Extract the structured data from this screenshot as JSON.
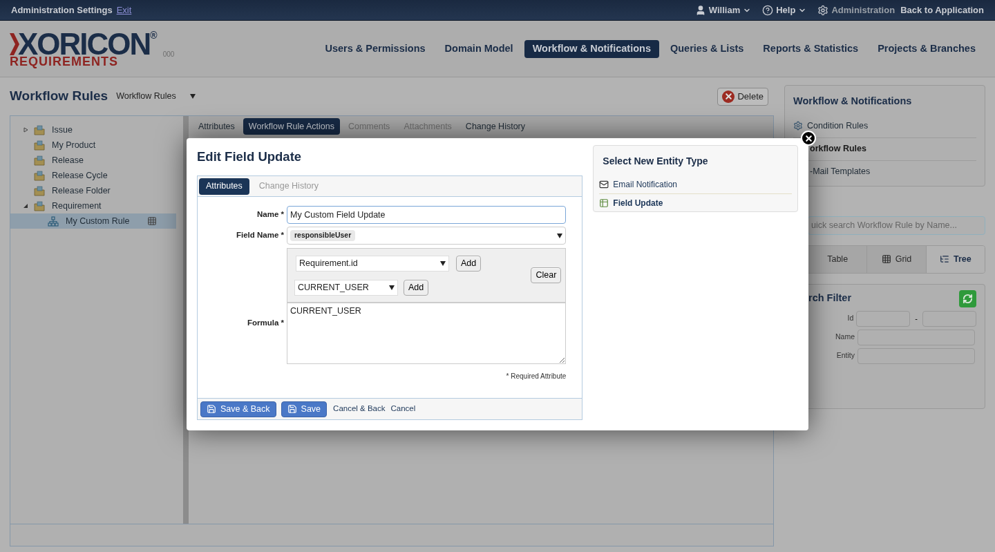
{
  "top_bar": {
    "title": "Administration Settings",
    "exit_link": "Exit",
    "user": "William",
    "help": "Help",
    "admin": "Administration",
    "back": "Back to Application"
  },
  "logo": {
    "main": "XORICON",
    "mark": "®",
    "sub": "REQUIREMENTS",
    "dots": "000"
  },
  "nav": [
    {
      "label": "Users & Permissions",
      "selected": false
    },
    {
      "label": "Domain Model",
      "selected": false
    },
    {
      "label": "Workflow & Notifications",
      "selected": true
    },
    {
      "label": "Queries & Lists",
      "selected": false
    },
    {
      "label": "Reports & Statistics",
      "selected": false
    },
    {
      "label": "Projects & Branches",
      "selected": false
    }
  ],
  "page": {
    "title": "Workflow Rules",
    "selector": "Workflow Rules",
    "delete_button": "Delete"
  },
  "tree": [
    {
      "label": "Issue",
      "expanded": false,
      "selected": false
    },
    {
      "label": "My Product",
      "selected": false
    },
    {
      "label": "Release",
      "selected": false
    },
    {
      "label": "Release Cycle",
      "selected": false
    },
    {
      "label": "Release Folder",
      "selected": false
    },
    {
      "label": "Requirement",
      "expanded": true,
      "selected": false,
      "children": [
        {
          "label": "My Custom Rule",
          "selected": true
        }
      ]
    }
  ],
  "content_tabs": [
    {
      "label": "Attributes",
      "selected": false,
      "disabled": false
    },
    {
      "label": "Workflow Rule Actions",
      "selected": true,
      "disabled": false
    },
    {
      "label": "Comments",
      "selected": false,
      "disabled": true
    },
    {
      "label": "Attachments",
      "selected": false,
      "disabled": true
    },
    {
      "label": "Change History",
      "selected": false,
      "disabled": false
    }
  ],
  "sidebar": {
    "title": "Workflow & Notifications",
    "items": [
      {
        "label": "Condition Rules",
        "selected": false
      },
      {
        "label": "orkflow Rules",
        "selected": true
      },
      {
        "label": "-Mail Templates",
        "selected": false
      }
    ],
    "search": {
      "placeholder": "uick search Workflow Rule by Name..."
    },
    "views": [
      {
        "label": "Table",
        "selected": false
      },
      {
        "label": "Grid",
        "selected": false
      },
      {
        "label": "Tree",
        "selected": true
      }
    ],
    "filter": {
      "title": "rch Filter",
      "fields": [
        {
          "label": "Id",
          "range_separator": "-"
        },
        {
          "label": "Name"
        },
        {
          "label": "Entity"
        }
      ]
    }
  },
  "dialog": {
    "title": "Edit Field Update",
    "tabs": [
      {
        "label": "Attributes",
        "selected": true
      },
      {
        "label": "Change History",
        "selected": false
      }
    ],
    "name_label": "Name",
    "name_value": "My Custom Field Update",
    "field_label": "Field Name",
    "field_value": "responsibleUser",
    "formula_label": "Formula",
    "required_mark": "*",
    "picker_1": "Requirement.id",
    "picker_2": "CURRENT_USER",
    "add_buttons": [
      "Add",
      "Add"
    ],
    "clear_button": "Clear",
    "formula_value": "CURRENT_USER",
    "required_note": "* Required Attribute",
    "buttons": [
      {
        "label": "Save & Back",
        "kind": "primary"
      },
      {
        "label": "Save",
        "kind": "primary"
      },
      {
        "label": "Cancel & Back",
        "kind": "link"
      },
      {
        "label": "Cancel",
        "kind": "link"
      }
    ],
    "entity_panel": {
      "title": "Select New Entity Type",
      "items": [
        {
          "label": "Email Notification",
          "kind": "mail",
          "selected": false
        },
        {
          "label": "Field Update",
          "kind": "field",
          "selected": true
        }
      ]
    }
  }
}
